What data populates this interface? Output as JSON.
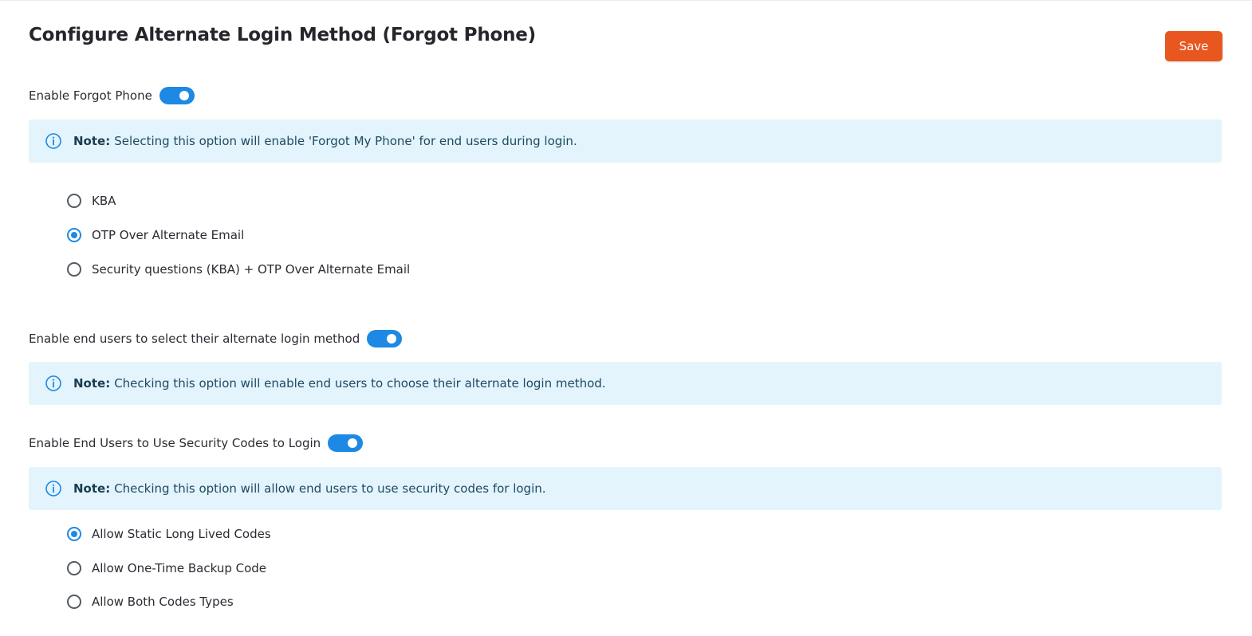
{
  "header": {
    "title": "Configure Alternate Login Method (Forgot Phone)",
    "save_label": "Save"
  },
  "forgot_phone": {
    "toggle_label": "Enable Forgot Phone",
    "enabled": true,
    "note_label": "Note:",
    "note_text": "Selecting this option will enable 'Forgot My Phone' for end users during login.",
    "options": [
      {
        "label": "KBA",
        "checked": false
      },
      {
        "label": "OTP Over Alternate Email",
        "checked": true
      },
      {
        "label": "Security questions (KBA) + OTP Over Alternate Email",
        "checked": false
      }
    ]
  },
  "select_method": {
    "toggle_label": "Enable end users to select their alternate login method",
    "enabled": true,
    "note_label": "Note:",
    "note_text": "Checking this option will enable end users to choose their alternate login method."
  },
  "security_codes": {
    "toggle_label": "Enable End Users to Use Security Codes to Login",
    "enabled": true,
    "note_label": "Note:",
    "note_text": "Checking this option will allow end users to use security codes for login.",
    "options": [
      {
        "label": "Allow Static Long Lived Codes",
        "checked": true
      },
      {
        "label": "Allow One-Time Backup Code",
        "checked": false
      },
      {
        "label": "Allow Both Codes Types",
        "checked": false
      }
    ]
  },
  "colors": {
    "accent": "#1d89e4",
    "save_button": "#e8571f",
    "note_background": "#e3f4fc"
  },
  "icons": {
    "note": "info-icon"
  }
}
